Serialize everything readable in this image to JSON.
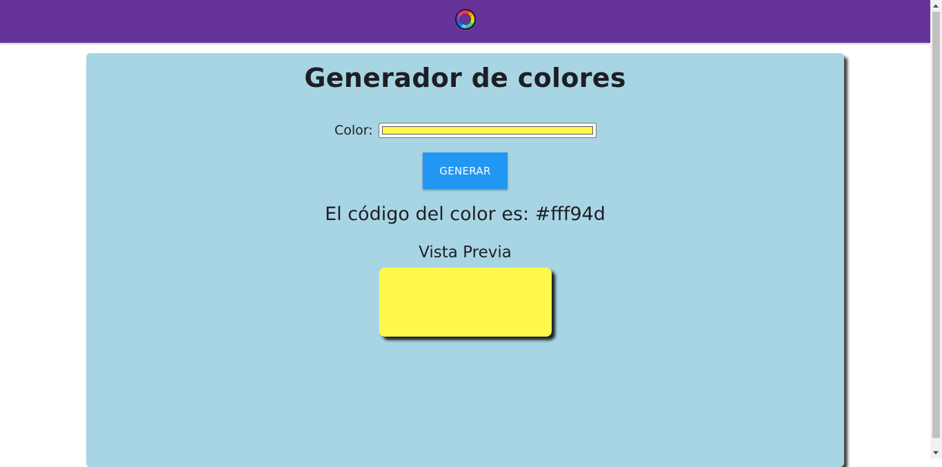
{
  "header": {
    "logo_icon": "color-wheel-icon",
    "background_color": "#663399"
  },
  "main": {
    "title": "Generador de colores",
    "color_label": "Color:",
    "color_value": "#fff94d",
    "generate_button_label": "GENERAR",
    "code_text": "El código del color es: #fff94d",
    "preview_label": "Vista Previa",
    "card_color": "#a8d5e4",
    "button_color": "#2196f3"
  }
}
